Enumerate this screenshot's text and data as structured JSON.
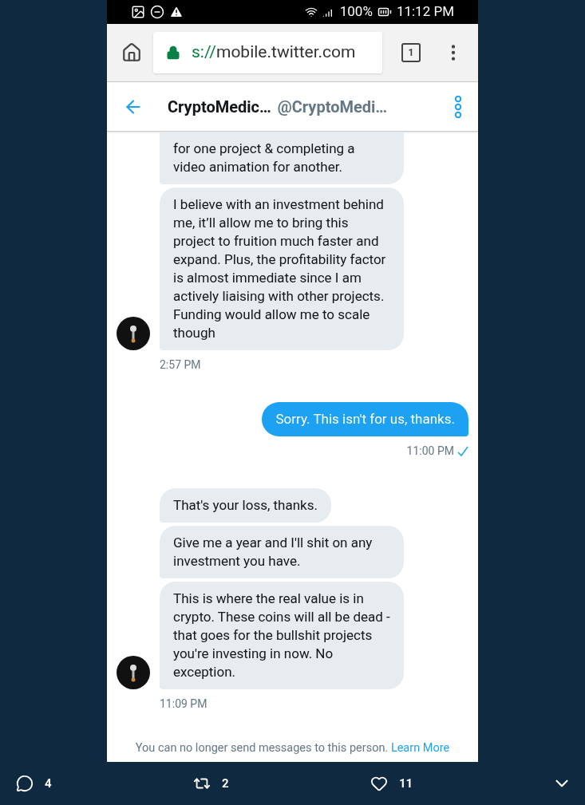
{
  "status_bar": {
    "battery": "100%",
    "time": "11:12 PM"
  },
  "browser": {
    "url_scheme": "s://",
    "url_host": "mobile.twitter.com",
    "tab_count": "1"
  },
  "conversation_header": {
    "name": "CryptoMedic…",
    "handle": "@CryptoMedi…"
  },
  "message_groups": [
    {
      "kind": "received",
      "bubbles": [
        "for one project & completing a video animation for another.",
        "I believe with an investment behind me, it’ll allow me to bring this project to fruition much faster and expand. Plus, the profitability factor is almost immediate since I am actively liaising with other projects. Funding would allow me to scale though"
      ],
      "time": "2:57 PM",
      "seen": false
    },
    {
      "kind": "sent",
      "bubbles": [
        "Sorry. This isn't for us, thanks."
      ],
      "time": "11:00 PM",
      "seen": true
    },
    {
      "kind": "received",
      "bubbles": [
        "That's your loss, thanks.",
        "Give me a year and I'll shit on any investment you have.",
        "This is where the real value is in crypto. These coins will all be dead - that goes for the bullshit projects you're investing in now. No exception."
      ],
      "time": "11:09 PM",
      "seen": false
    }
  ],
  "notice": {
    "text": "You can no longer send messages to this person.",
    "link": "Learn More"
  },
  "tweet_actions": [
    {
      "kind": "reply",
      "count": "4"
    },
    {
      "kind": "retweet",
      "count": "2"
    },
    {
      "kind": "like",
      "count": "11"
    }
  ]
}
